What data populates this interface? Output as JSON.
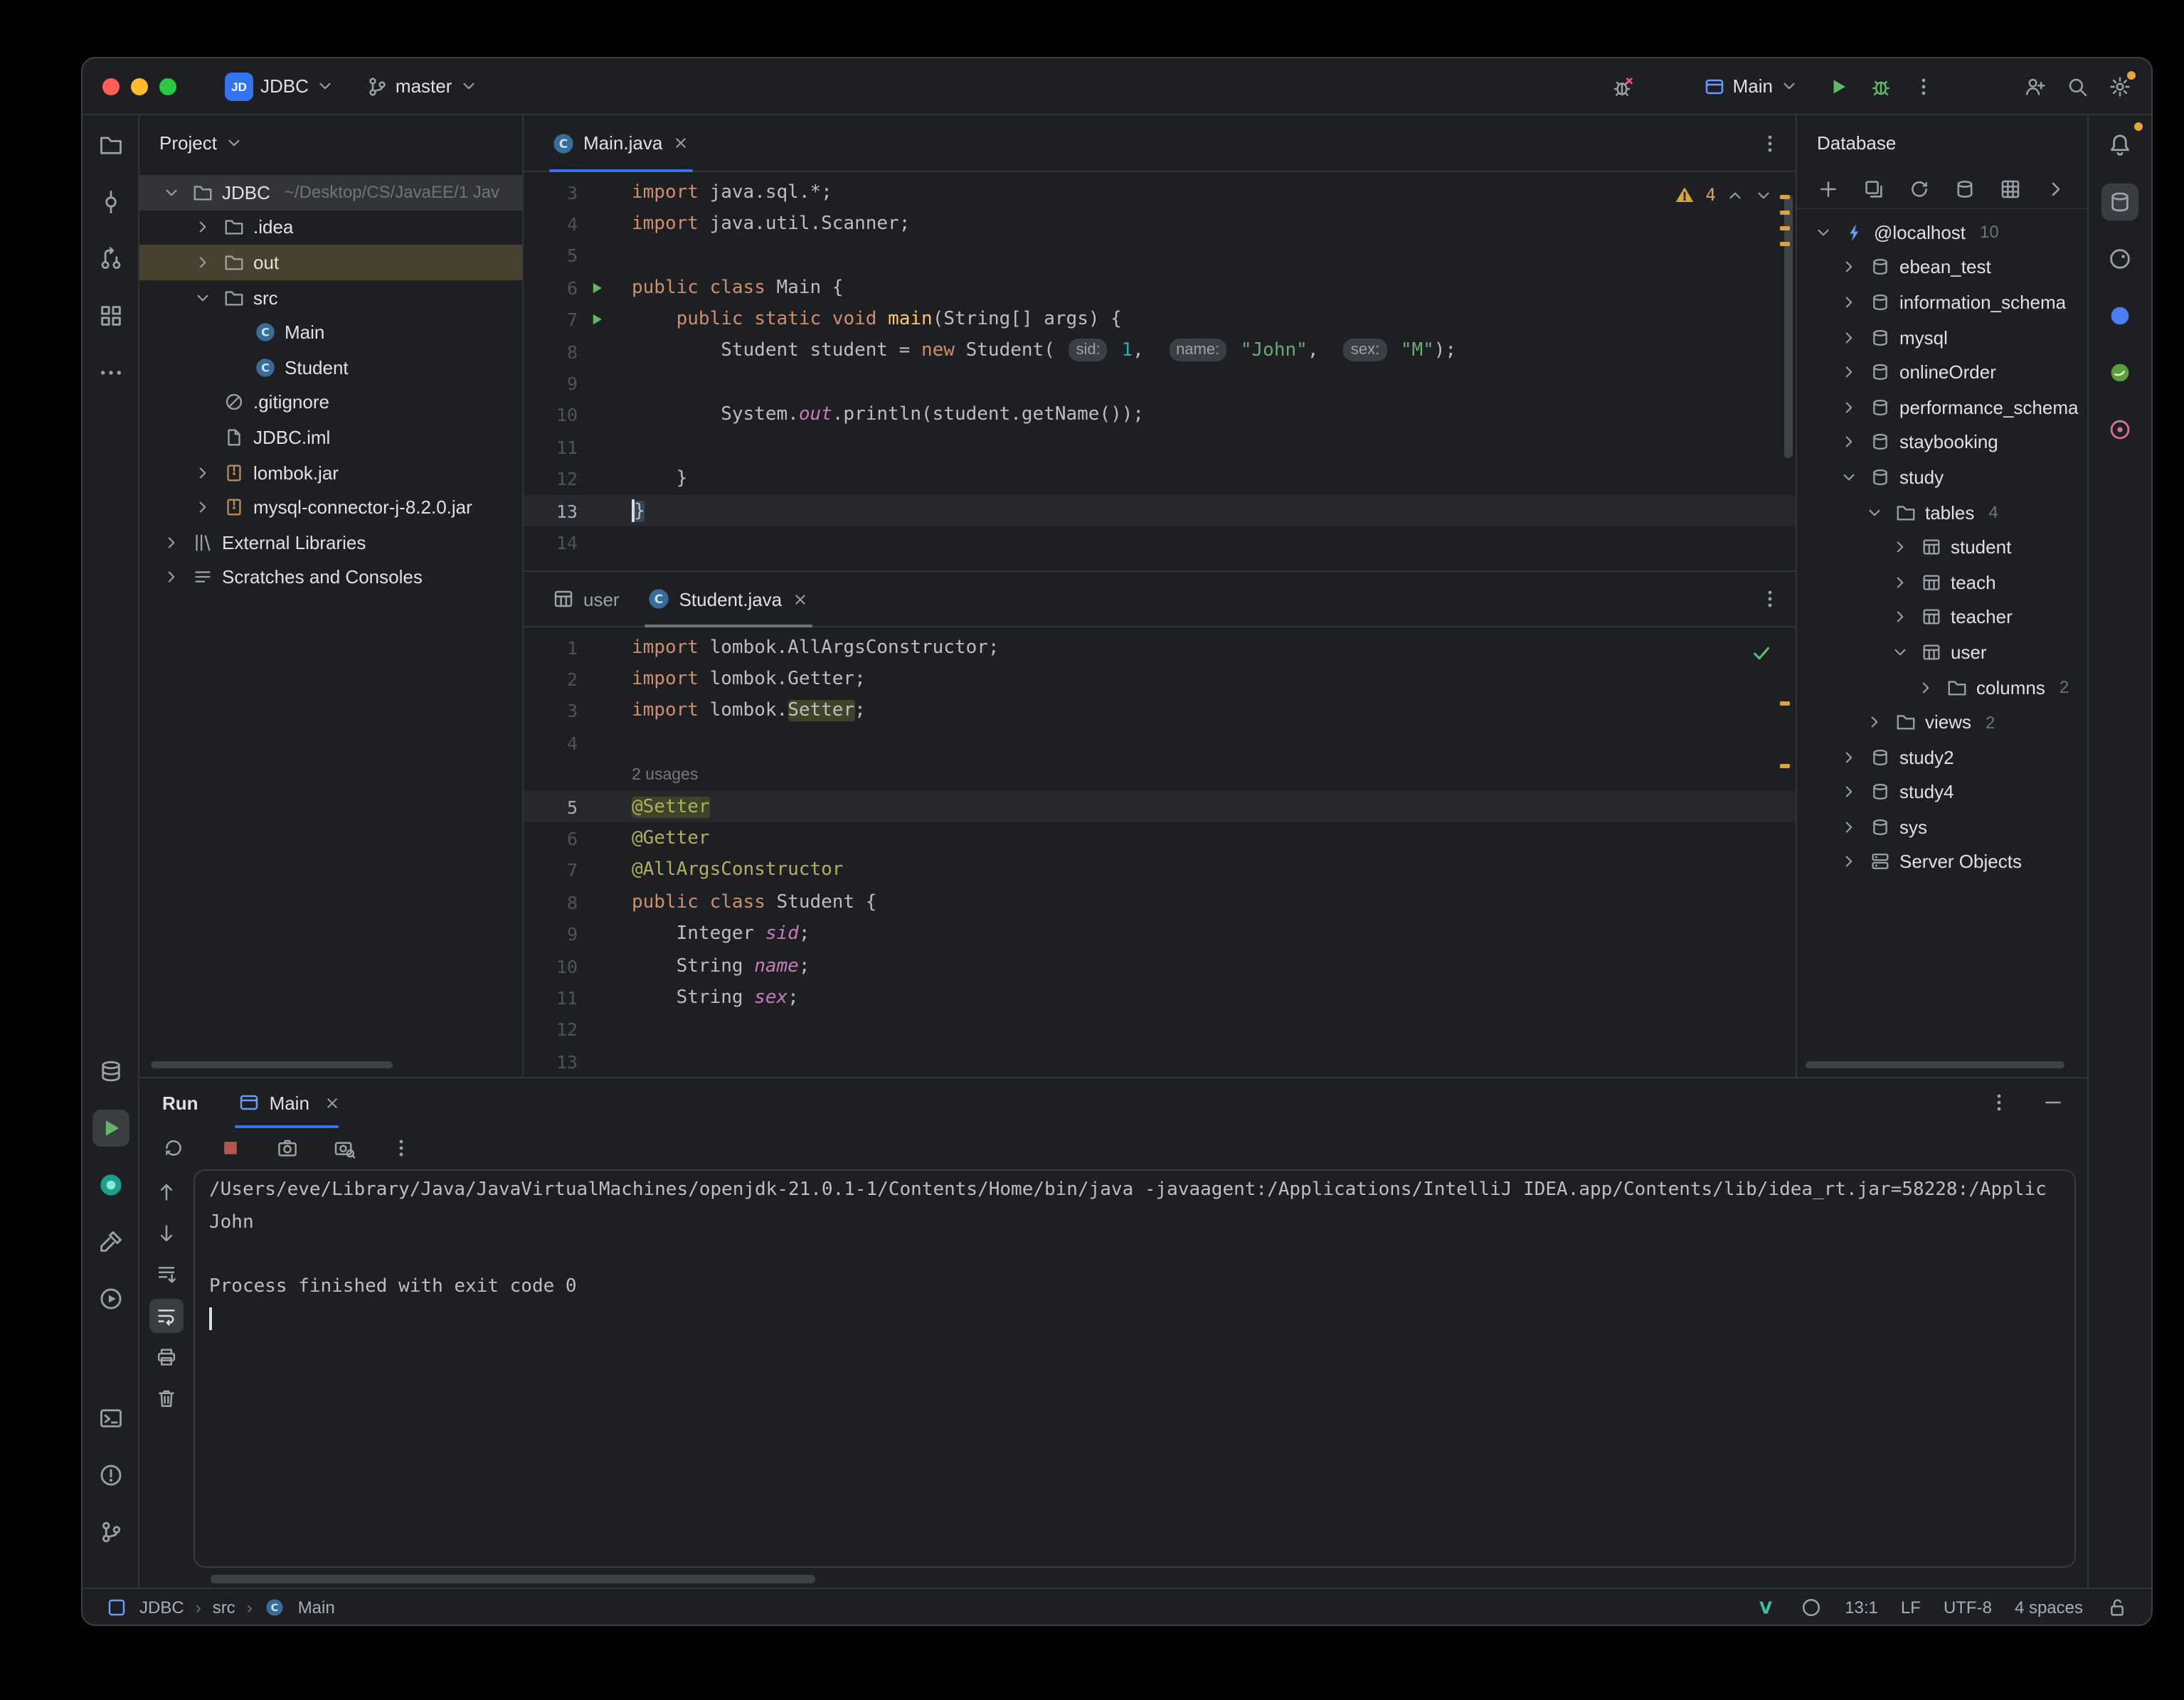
{
  "colors": {
    "accent": "#3574f0",
    "run_green": "#5fb865",
    "warning_yellow": "#d9a343",
    "error_red": "#e55765",
    "badge_orange": "#e8a33d",
    "editor_bg": "#1e1f22"
  },
  "titlebar": {
    "logo": "JD",
    "project": "JDBC",
    "branch": "master",
    "run_config": "Main"
  },
  "left_rail": [
    {
      "name": "project-tool-button",
      "icon": "folder-icon"
    },
    {
      "name": "commit-tool-button",
      "icon": "commit-icon"
    },
    {
      "name": "pull-requests-tool-button",
      "icon": "pull-request-icon"
    },
    {
      "name": "structure-tool-button",
      "icon": "structure-icon"
    },
    {
      "name": "more-tool-windows-button",
      "icon": "more-icon"
    },
    {
      "flex": true
    },
    {
      "name": "services-tool-button",
      "icon": "services-icon"
    },
    {
      "name": "run-tool-button",
      "icon": "run-play-icon",
      "selected": true
    },
    {
      "name": "docker-tool-button",
      "icon": "docker-icon"
    },
    {
      "name": "build-tool-button",
      "icon": "hammer-icon"
    },
    {
      "name": "profiler-tool-button",
      "icon": "play-circle-icon"
    },
    {
      "spacer": 44
    },
    {
      "name": "terminal-tool-button",
      "icon": "terminal-icon"
    },
    {
      "name": "problems-tool-button",
      "icon": "problems-icon"
    },
    {
      "name": "version-control-tool-button",
      "icon": "git-branch-icon"
    }
  ],
  "right_rail": [
    {
      "name": "notifications-button",
      "icon": "bell-icon",
      "badge": true
    },
    {
      "name": "database-tool-button",
      "icon": "schema-icon",
      "selected": true
    },
    {
      "name": "gradle-tool-button",
      "icon": "gradle-icon"
    },
    {
      "name": "maven-tool-button",
      "icon": "maven-icon"
    },
    {
      "name": "spring-tool-button",
      "icon": "spring-icon"
    },
    {
      "name": "endpoints-tool-button",
      "icon": "endpoints-icon",
      "color": "#e06c9f"
    }
  ],
  "project_panel": {
    "header": "Project",
    "tree": [
      {
        "depth": 0,
        "chevron": "down",
        "icon": "folder-icon",
        "label": "JDBC",
        "extra": "~/Desktop/CS/JavaEE/1 Jav",
        "row": "band"
      },
      {
        "depth": 1,
        "chevron": "right",
        "icon": "folder-icon",
        "label": ".idea"
      },
      {
        "depth": 1,
        "chevron": "right",
        "icon": "folder-icon",
        "label": "out",
        "row": "warm"
      },
      {
        "depth": 1,
        "chevron": "down",
        "icon": "folder-icon",
        "label": "src"
      },
      {
        "depth": 2,
        "chevron": "none",
        "icon": "class-icon",
        "label": "Main"
      },
      {
        "depth": 2,
        "chevron": "none",
        "icon": "class-icon",
        "label": "Student"
      },
      {
        "depth": 1,
        "chevron": "none",
        "icon": "ignored-icon",
        "label": ".gitignore"
      },
      {
        "depth": 1,
        "chevron": "none",
        "icon": "file-icon",
        "label": "JDBC.iml"
      },
      {
        "depth": 1,
        "chevron": "right",
        "icon": "jar-icon",
        "label": "lombok.jar",
        "iconColor": "#bc8a5f"
      },
      {
        "depth": 1,
        "chevron": "right",
        "icon": "jar-icon",
        "label": "mysql-connector-j-8.2.0.jar",
        "iconColor": "#bc8a5f"
      },
      {
        "depth": 0,
        "chevron": "right",
        "icon": "libs-icon",
        "label": "External Libraries"
      },
      {
        "depth": 0,
        "chevron": "right",
        "icon": "scratch-icon",
        "label": "Scratches and Consoles"
      }
    ]
  },
  "editors": {
    "main": {
      "tab": "Main.java",
      "warning_count": "4",
      "stripe_marks": [
        16,
        27,
        38,
        49
      ],
      "lines": [
        {
          "n": "3",
          "tok": [
            [
              "kw",
              "import"
            ],
            [
              "pl",
              " java.sql.*;"
            ]
          ]
        },
        {
          "n": "4",
          "tok": [
            [
              "kw",
              "import"
            ],
            [
              "pl",
              " java.util.Scanner;"
            ]
          ]
        },
        {
          "n": "5",
          "tok": []
        },
        {
          "n": "6",
          "run": true,
          "tok": [
            [
              "kw",
              "public"
            ],
            [
              "pl",
              " "
            ],
            [
              "kw",
              "class"
            ],
            [
              "pl",
              " Main {"
            ]
          ]
        },
        {
          "n": "7",
          "run": true,
          "tok": [
            [
              "pl",
              "    "
            ],
            [
              "kw",
              "public"
            ],
            [
              "pl",
              " "
            ],
            [
              "kw",
              "static"
            ],
            [
              "pl",
              " "
            ],
            [
              "kw",
              "void"
            ],
            [
              "pl",
              " "
            ],
            [
              "mth",
              "main"
            ],
            [
              "pl",
              "(String[] args) {"
            ]
          ]
        },
        {
          "n": "8",
          "tok": [
            [
              "pl",
              "        Student student = "
            ],
            [
              "kw",
              "new"
            ],
            [
              "pl",
              " Student( "
            ],
            [
              "inlay",
              "sid:"
            ],
            [
              "pl",
              " "
            ],
            [
              "num",
              "1"
            ],
            [
              "pl",
              ",  "
            ],
            [
              "inlay",
              "name:"
            ],
            [
              "pl",
              " "
            ],
            [
              "str",
              "\"John\""
            ],
            [
              "pl",
              ",  "
            ],
            [
              "inlay",
              "sex:"
            ],
            [
              "pl",
              " "
            ],
            [
              "str",
              "\"M\""
            ],
            [
              "pl",
              ");"
            ]
          ]
        },
        {
          "n": "9",
          "tok": []
        },
        {
          "n": "10",
          "tok": [
            [
              "pl",
              "        System."
            ],
            [
              "fld",
              "out"
            ],
            [
              "pl",
              ".println(student.getName());"
            ]
          ]
        },
        {
          "n": "11",
          "tok": []
        },
        {
          "n": "12",
          "tok": [
            [
              "pl",
              "    }"
            ]
          ]
        },
        {
          "n": "13",
          "cur": true,
          "caret": true,
          "tok": [
            [
              "pl brace",
              "}"
            ]
          ]
        },
        {
          "n": "14",
          "tok": []
        }
      ]
    },
    "student": {
      "tabs": [
        "user",
        "Student.java"
      ],
      "stripe_marks": [
        52,
        96
      ],
      "lines": [
        {
          "n": "1",
          "tok": [
            [
              "kw",
              "import"
            ],
            [
              "pl",
              " lombok.AllArgsConstructor;"
            ]
          ]
        },
        {
          "n": "2",
          "tok": [
            [
              "kw",
              "import"
            ],
            [
              "pl",
              " lombok.Getter;"
            ]
          ]
        },
        {
          "n": "3",
          "tok": [
            [
              "kw",
              "import"
            ],
            [
              "pl",
              " lombok."
            ],
            [
              "pl hl",
              "Setter"
            ],
            [
              "pl",
              ";"
            ]
          ]
        },
        {
          "n": "4",
          "tok": []
        },
        {
          "n": "",
          "tok": [
            [
              "use",
              "2 usages"
            ]
          ]
        },
        {
          "n": "5",
          "cur": true,
          "tok": [
            [
              "ann hl",
              "@Setter"
            ]
          ]
        },
        {
          "n": "6",
          "tok": [
            [
              "ann",
              "@Getter"
            ]
          ]
        },
        {
          "n": "7",
          "tok": [
            [
              "ann",
              "@AllArgsConstructor"
            ]
          ]
        },
        {
          "n": "8",
          "tok": [
            [
              "kw",
              "public"
            ],
            [
              "pl",
              " "
            ],
            [
              "kw",
              "class"
            ],
            [
              "pl",
              " Student {"
            ]
          ]
        },
        {
          "n": "9",
          "tok": [
            [
              "pl",
              "    Integer "
            ],
            [
              "fld",
              "sid"
            ],
            [
              "pl",
              ";"
            ]
          ]
        },
        {
          "n": "10",
          "tok": [
            [
              "pl",
              "    String "
            ],
            [
              "fld",
              "name"
            ],
            [
              "pl",
              ";"
            ]
          ]
        },
        {
          "n": "11",
          "tok": [
            [
              "pl",
              "    String "
            ],
            [
              "fld",
              "sex"
            ],
            [
              "pl",
              ";"
            ]
          ]
        },
        {
          "n": "12",
          "tok": []
        },
        {
          "n": "13",
          "tok": []
        }
      ]
    }
  },
  "database_panel": {
    "header": "Database",
    "toolbar": [
      {
        "name": "add-data-source-button",
        "icon": "plus-icon"
      },
      {
        "name": "duplicate-button",
        "icon": "copy-icon"
      },
      {
        "name": "refresh-button",
        "icon": "refresh-icon"
      },
      {
        "name": "schema-sync-button",
        "icon": "schema-icon"
      },
      {
        "name": "data-view-button",
        "icon": "grid-icon"
      },
      {
        "name": "expand-toolbar-button",
        "icon": "chevron-right-icon"
      }
    ],
    "tree": [
      {
        "depth": 0,
        "chevron": "down",
        "icon": "plug-icon",
        "label": "@localhost",
        "extra": "10"
      },
      {
        "depth": 1,
        "chevron": "right",
        "icon": "schema-icon",
        "label": "ebean_test"
      },
      {
        "depth": 1,
        "chevron": "right",
        "icon": "schema-icon",
        "label": "information_schema"
      },
      {
        "depth": 1,
        "chevron": "right",
        "icon": "schema-icon",
        "label": "mysql"
      },
      {
        "depth": 1,
        "chevron": "right",
        "icon": "schema-icon",
        "label": "onlineOrder"
      },
      {
        "depth": 1,
        "chevron": "right",
        "icon": "schema-icon",
        "label": "performance_schema"
      },
      {
        "depth": 1,
        "chevron": "right",
        "icon": "schema-icon",
        "label": "staybooking"
      },
      {
        "depth": 1,
        "chevron": "down",
        "icon": "schema-icon",
        "label": "study"
      },
      {
        "depth": 2,
        "chevron": "down",
        "icon": "folder-icon",
        "label": "tables",
        "extra": "4"
      },
      {
        "depth": 3,
        "chevron": "right",
        "icon": "table-icon",
        "label": "student"
      },
      {
        "depth": 3,
        "chevron": "right",
        "icon": "table-icon",
        "label": "teach"
      },
      {
        "depth": 3,
        "chevron": "right",
        "icon": "table-icon",
        "label": "teacher"
      },
      {
        "depth": 3,
        "chevron": "down",
        "icon": "table-icon",
        "label": "user"
      },
      {
        "depth": 4,
        "chevron": "right",
        "icon": "folder-icon",
        "label": "columns",
        "extra": "2"
      },
      {
        "depth": 2,
        "chevron": "right",
        "icon": "folder-icon",
        "label": "views",
        "extra": "2"
      },
      {
        "depth": 1,
        "chevron": "right",
        "icon": "schema-icon",
        "label": "study2"
      },
      {
        "depth": 1,
        "chevron": "right",
        "icon": "schema-icon",
        "label": "study4"
      },
      {
        "depth": 1,
        "chevron": "right",
        "icon": "schema-icon",
        "label": "sys"
      },
      {
        "depth": 1,
        "chevron": "right",
        "icon": "server-icon",
        "label": "Server Objects"
      }
    ]
  },
  "run_panel": {
    "title": "Run",
    "tab": "Main",
    "toolbar_top": [
      {
        "name": "rerun-button",
        "icon": "rerun-icon"
      },
      {
        "name": "stop-button",
        "icon": "stop-icon"
      },
      {
        "name": "thread-dump-button",
        "icon": "camera-icon"
      },
      {
        "name": "memory-snapshot-button",
        "icon": "camera-search-icon"
      },
      {
        "name": "more-options-button",
        "icon": "kebab-icon"
      }
    ],
    "toolbar_left": [
      {
        "name": "up-stack-trace-button",
        "icon": "arrow-up-icon"
      },
      {
        "name": "down-stack-trace-button",
        "icon": "arrow-down-icon"
      },
      {
        "name": "scroll-to-end-button",
        "icon": "scroll-end-icon"
      },
      {
        "name": "soft-wrap-button",
        "icon": "soft-wrap-icon",
        "selected": true
      },
      {
        "name": "print-button",
        "icon": "print-icon"
      },
      {
        "name": "clear-console-button",
        "icon": "trash-icon"
      }
    ],
    "console": [
      {
        "text": "/Users/eve/Library/Java/JavaVirtualMachines/openjdk-21.0.1-1/Contents/Home/bin/java -javaagent:/Applications/IntelliJ IDEA.app/Contents/lib/idea_rt.jar=58228:/Applic"
      },
      {
        "text": "John"
      },
      {
        "text": ""
      },
      {
        "text": "Process finished with exit code 0"
      },
      {
        "text": "",
        "caret": true
      }
    ]
  },
  "statusbar": {
    "crumbs": [
      "JDBC",
      "src",
      "Main"
    ],
    "separator": "›",
    "caret_position": "13:1",
    "line_separator": "LF",
    "encoding": "UTF-8",
    "indent": "4 spaces"
  }
}
